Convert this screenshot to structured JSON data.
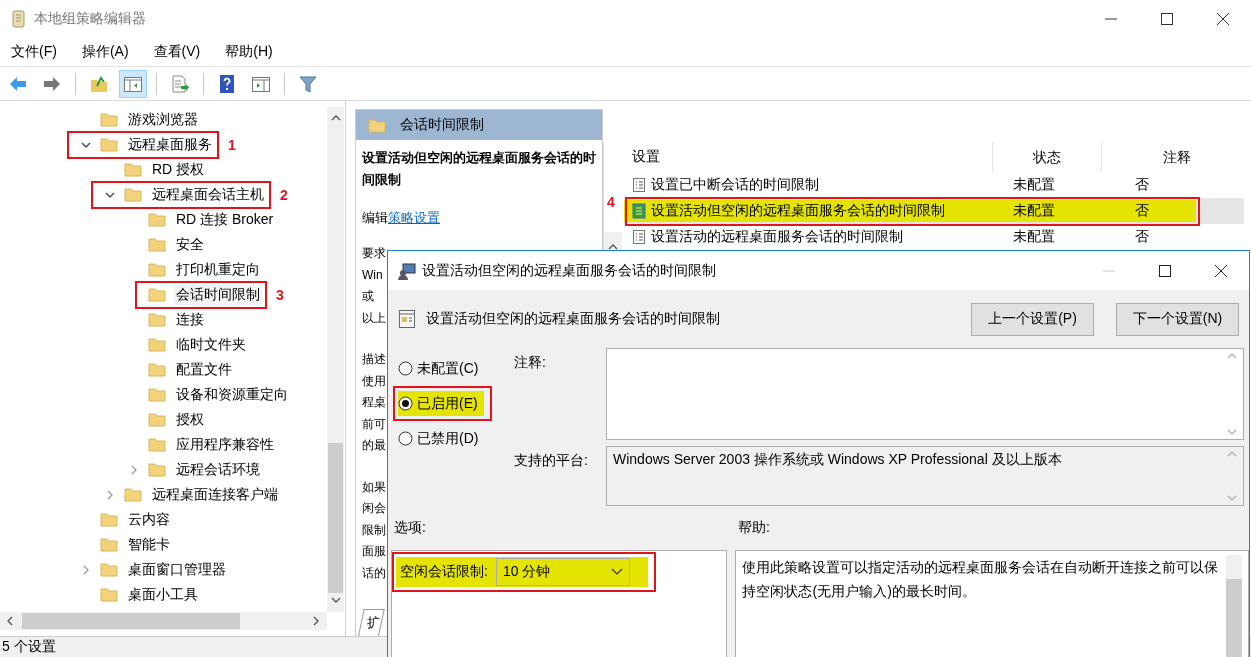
{
  "window": {
    "title": "本地组策略编辑器"
  },
  "menu": [
    "文件(F)",
    "操作(A)",
    "查看(V)",
    "帮助(H)"
  ],
  "toolbar": [
    {
      "kind": "back",
      "active": false
    },
    {
      "kind": "forward",
      "active": false
    },
    {
      "kind": "sep"
    },
    {
      "kind": "up",
      "active": false
    },
    {
      "kind": "tree-toggle",
      "active": true
    },
    {
      "kind": "sep"
    },
    {
      "kind": "export",
      "active": false
    },
    {
      "kind": "sep"
    },
    {
      "kind": "help",
      "active": false
    },
    {
      "kind": "pane",
      "active": false
    },
    {
      "kind": "sep"
    },
    {
      "kind": "filter",
      "active": false
    }
  ],
  "tree": {
    "items": [
      {
        "label": "游戏浏览器",
        "selected": false
      },
      {
        "label": "远程桌面服务",
        "selected": false,
        "expanded": true,
        "annotation": "1",
        "children": [
          {
            "label": "RD 授权",
            "selected": false
          },
          {
            "label": "远程桌面会话主机",
            "selected": false,
            "expanded": true,
            "annotation": "2",
            "children": [
              {
                "label": "RD 连接 Broker",
                "selected": false
              },
              {
                "label": "安全",
                "selected": false
              },
              {
                "label": "打印机重定向",
                "selected": false
              },
              {
                "label": "会话时间限制",
                "selected": true,
                "annotation": "3"
              },
              {
                "label": "连接",
                "selected": false
              },
              {
                "label": "临时文件夹",
                "selected": false
              },
              {
                "label": "配置文件",
                "selected": false
              },
              {
                "label": "设备和资源重定向",
                "selected": false
              },
              {
                "label": "授权",
                "selected": false
              },
              {
                "label": "应用程序兼容性",
                "selected": false
              },
              {
                "label": "远程会话环境",
                "selected": false,
                "expanded": false
              }
            ]
          },
          {
            "label": "远程桌面连接客户端",
            "selected": false,
            "expanded": false
          }
        ]
      },
      {
        "label": "云内容",
        "selected": false
      },
      {
        "label": "智能卡",
        "selected": false
      },
      {
        "label": "桌面窗口管理器",
        "selected": false,
        "expanded": false
      },
      {
        "label": "桌面小工具",
        "selected": false
      }
    ]
  },
  "description": {
    "header": "会话时间限制",
    "title": "设置活动但空闲的远程桌面服务会话的时间限制",
    "edit_prefix": "编辑",
    "edit_link": "策略设置",
    "paragraphs": [
      [
        "要求",
        "Win",
        "或",
        "以上"
      ],
      [
        "描述",
        "使用",
        "程桌",
        "前可",
        "的最"
      ],
      [
        "如果",
        "闲会",
        "限制",
        "面服",
        "话的"
      ]
    ],
    "tab": "扩"
  },
  "settings_list": {
    "columns": [
      "设置",
      "状态",
      "注释"
    ],
    "rows": [
      {
        "name": "设置已中断会话的时间限制",
        "state": "未配置",
        "comment": "否",
        "selected": false,
        "highlighted": false
      },
      {
        "name": "设置活动但空闲的远程桌面服务会话的时间限制",
        "state": "未配置",
        "comment": "否",
        "selected": true,
        "highlighted": true,
        "annotation": "4"
      },
      {
        "name": "设置活动的远程桌面服务会话的时间限制",
        "state": "未配置",
        "comment": "否",
        "selected": false,
        "highlighted": false
      }
    ]
  },
  "dialog": {
    "title": "设置活动但空闲的远程桌面服务会话的时间限制",
    "setting_title": "设置活动但空闲的远程桌面服务会话的时间限制",
    "buttons": [
      "上一个设置(P)",
      "下一个设置(N)"
    ],
    "radios": [
      {
        "label": "未配置(C)",
        "selected": false,
        "highlighted": false,
        "boxed": false
      },
      {
        "label": "已启用(E)",
        "selected": true,
        "highlighted": true,
        "boxed": true
      },
      {
        "label": "已禁用(D)",
        "selected": false,
        "highlighted": false,
        "boxed": false
      }
    ],
    "comment_label": "注释:",
    "platform_label": "支持的平台:",
    "platform": "Windows Server 2003 操作系统或 Windows XP Professional 及以上版本",
    "options_label": "选项:",
    "help_label": "帮助:",
    "option": {
      "label": "空闲会话限制:",
      "value": "10 分钟",
      "highlighted": true,
      "boxed": true
    },
    "help": "使用此策略设置可以指定活动的远程桌面服务会话在自动断开连接之前可以保持空闲状态(无用户输入)的最长时间。"
  },
  "status_bar": "5 个设置"
}
